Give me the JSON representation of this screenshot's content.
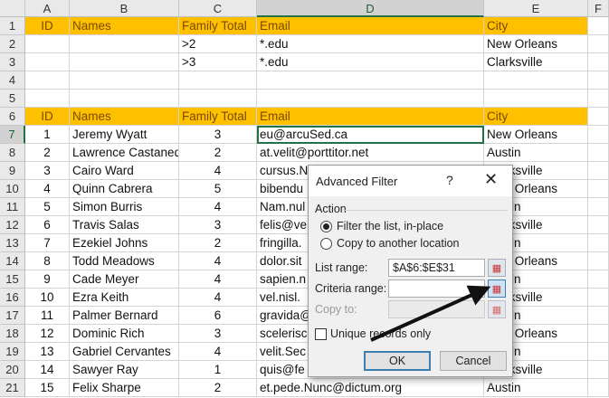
{
  "columns": [
    "A",
    "B",
    "C",
    "D",
    "E",
    "F"
  ],
  "selected_column": "D",
  "selected_row": 7,
  "rows": [
    {
      "num": "1",
      "cells": [
        "ID",
        "Names",
        "Family Total",
        "Email",
        "City"
      ],
      "header": true
    },
    {
      "num": "2",
      "cells": [
        "",
        "",
        ">2",
        "*.edu",
        "New Orleans"
      ]
    },
    {
      "num": "3",
      "cells": [
        "",
        "",
        ">3",
        "*.edu",
        "Clarksville"
      ]
    },
    {
      "num": "4",
      "cells": [
        "",
        "",
        "",
        "",
        ""
      ]
    },
    {
      "num": "5",
      "cells": [
        "",
        "",
        "",
        "",
        ""
      ]
    },
    {
      "num": "6",
      "cells": [
        "ID",
        "Names",
        "Family Total",
        "Email",
        "City"
      ],
      "header": true
    },
    {
      "num": "7",
      "cells": [
        "1",
        "Jeremy Wyatt",
        "3",
        "eu@arcuSed.ca",
        "New Orleans"
      ]
    },
    {
      "num": "8",
      "cells": [
        "2",
        "Lawrence Castaneda",
        "2",
        "at.velit@porttitor.net",
        "Austin"
      ]
    },
    {
      "num": "9",
      "cells": [
        "3",
        "Cairo Ward",
        "4",
        "cursus.N",
        "Clarksville"
      ]
    },
    {
      "num": "10",
      "cells": [
        "4",
        "Quinn Cabrera",
        "5",
        "bibendu",
        "New Orleans"
      ]
    },
    {
      "num": "11",
      "cells": [
        "5",
        "Simon Burris",
        "4",
        "Nam.nul",
        "Austin"
      ]
    },
    {
      "num": "12",
      "cells": [
        "6",
        "Travis Salas",
        "3",
        "felis@ve",
        "Clarksville"
      ]
    },
    {
      "num": "13",
      "cells": [
        "7",
        "Ezekiel Johns",
        "2",
        "fringilla.",
        "Austin"
      ]
    },
    {
      "num": "14",
      "cells": [
        "8",
        "Todd Meadows",
        "4",
        "dolor.sit",
        "New Orleans"
      ]
    },
    {
      "num": "15",
      "cells": [
        "9",
        "Cade Meyer",
        "4",
        "sapien.n",
        "Austin"
      ]
    },
    {
      "num": "16",
      "cells": [
        "10",
        "Ezra Keith",
        "4",
        "vel.nisl.",
        "Clarksville"
      ]
    },
    {
      "num": "17",
      "cells": [
        "11",
        "Palmer Bernard",
        "6",
        "gravida@",
        "Austin"
      ]
    },
    {
      "num": "18",
      "cells": [
        "12",
        "Dominic Rich",
        "3",
        "scelerisc",
        "New Orleans"
      ]
    },
    {
      "num": "19",
      "cells": [
        "13",
        "Gabriel Cervantes",
        "4",
        "velit.Sec",
        "Austin"
      ]
    },
    {
      "num": "20",
      "cells": [
        "14",
        "Sawyer Ray",
        "1",
        "quis@fe",
        "Clarksville"
      ]
    },
    {
      "num": "21",
      "cells": [
        "15",
        "Felix Sharpe",
        "2",
        "et.pede.Nunc@dictum.org",
        "Austin"
      ]
    }
  ],
  "colors": {
    "header_fill": "#ffc000",
    "selection": "#217346"
  },
  "dialog": {
    "title": "Advanced Filter",
    "help": "?",
    "close": "✕",
    "action_label": "Action",
    "option_filter": "Filter the list, in-place",
    "option_copy": "Copy to another location",
    "selected_option": "filter",
    "list_range_label": "List range:",
    "list_range_value": "$A$6:$E$31",
    "criteria_range_label": "Criteria range:",
    "criteria_range_value": "",
    "copy_to_label": "Copy to:",
    "unique_label": "Unique records only",
    "unique_checked": false,
    "ok": "OK",
    "cancel": "Cancel"
  }
}
